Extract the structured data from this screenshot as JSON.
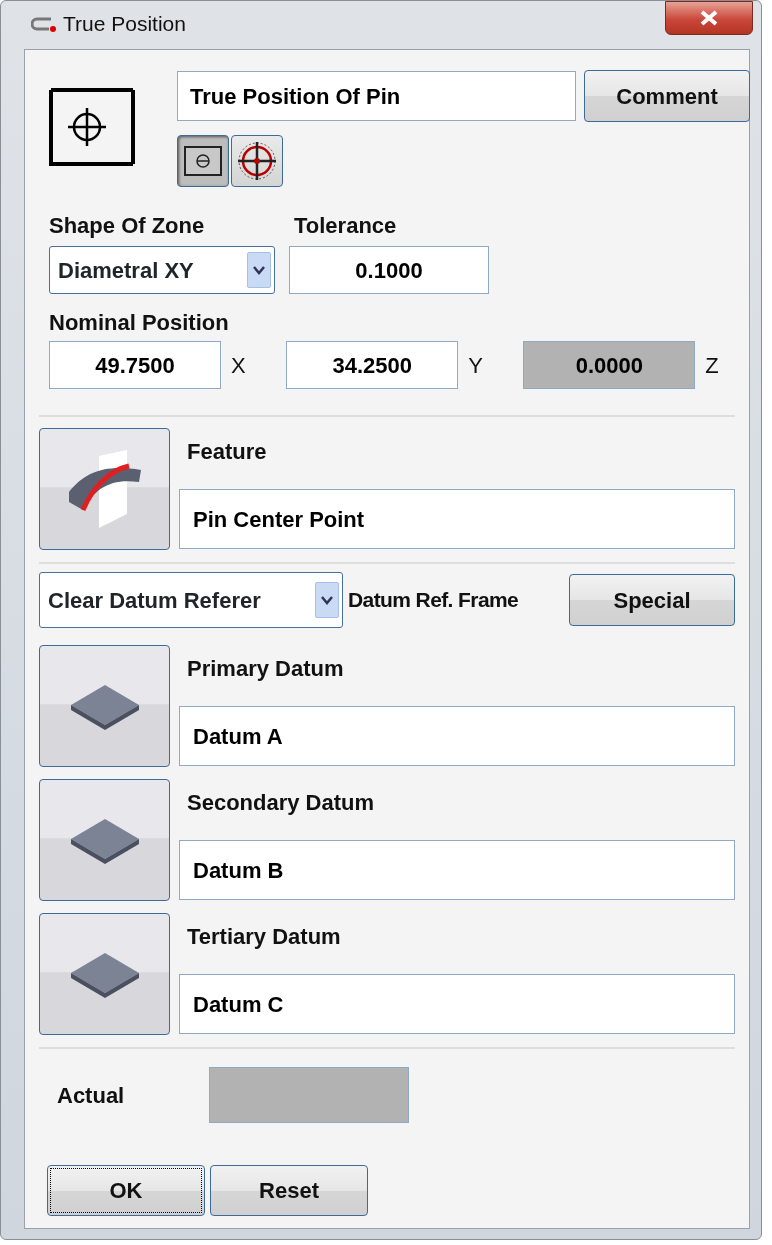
{
  "window": {
    "title": "True Position"
  },
  "characteristic": {
    "name": "True Position Of Pin",
    "comment_button": "Comment"
  },
  "mode_toggles": [
    {
      "kind": "zone",
      "selected": true
    },
    {
      "kind": "target",
      "selected": false
    }
  ],
  "shape_of_zone": {
    "label": "Shape Of Zone",
    "value": "Diametral XY"
  },
  "tolerance": {
    "label": "Tolerance",
    "value": "0.1000"
  },
  "nominal_position": {
    "label": "Nominal Position",
    "coords": [
      {
        "value": "49.7500",
        "axis": "X",
        "disabled": false
      },
      {
        "value": "34.2500",
        "axis": "Y",
        "disabled": false
      },
      {
        "value": "0.0000",
        "axis": "Z",
        "disabled": true
      }
    ]
  },
  "feature": {
    "label": "Feature",
    "value": "Pin Center Point"
  },
  "datum_ref_frame": {
    "select_value": "Clear Datum Referer",
    "label": "Datum Ref. Frame",
    "special_button": "Special"
  },
  "datums": [
    {
      "label": "Primary Datum",
      "value": "Datum A"
    },
    {
      "label": "Secondary Datum",
      "value": "Datum B"
    },
    {
      "label": "Tertiary Datum",
      "value": "Datum C"
    }
  ],
  "actual": {
    "label": "Actual",
    "disabled": true
  },
  "buttons": [
    {
      "label": "OK",
      "focused": true
    },
    {
      "label": "Reset",
      "focused": false
    }
  ]
}
